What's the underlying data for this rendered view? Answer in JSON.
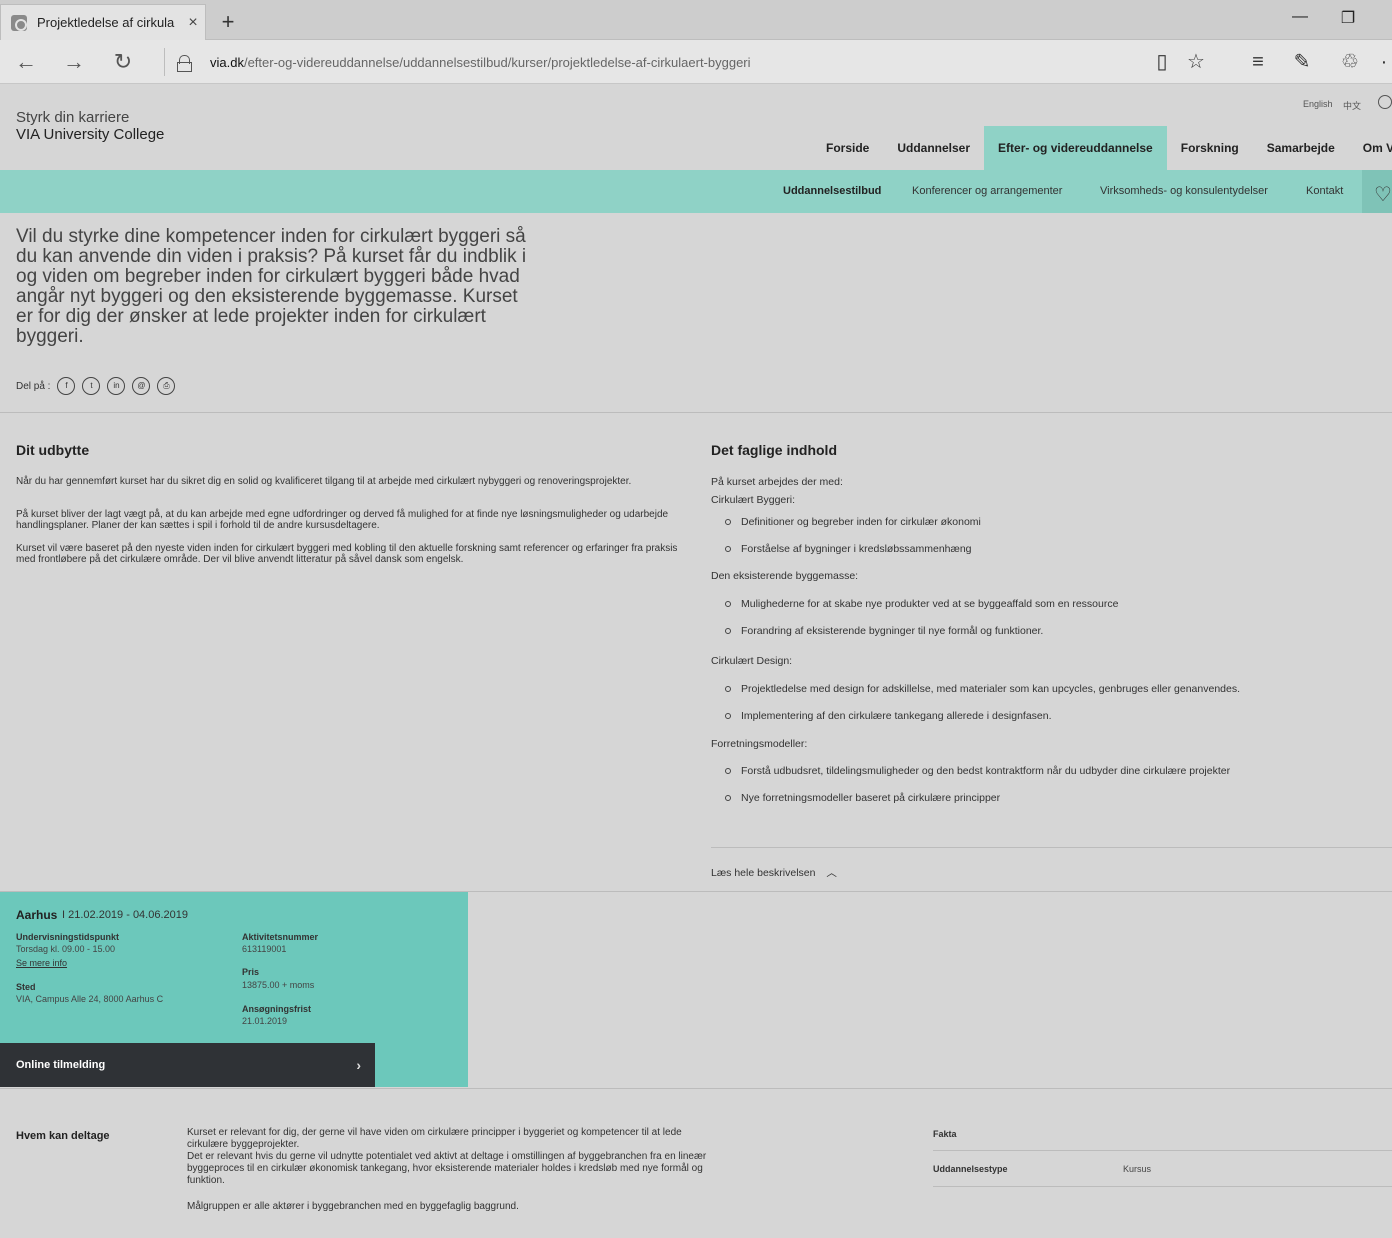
{
  "browser": {
    "tab_title": "Projektledelse af cirkula",
    "close_label": "×",
    "new_tab_label": "+",
    "minimize_label": "—",
    "restore_label": "❐",
    "more_label": "·",
    "url_domain": "via.dk",
    "url_path": "/efter-og-videreuddannelse/uddannelsestilbud/kurser/projektledelse-af-cirkulaert-byggeri"
  },
  "header": {
    "tagline": "Styrk din karriere",
    "college": "VIA University College",
    "lang_english": "English",
    "lang_chinese": "中文"
  },
  "main_nav": [
    {
      "label": "Forside"
    },
    {
      "label": "Uddannelser"
    },
    {
      "label": "Efter- og videreuddannelse"
    },
    {
      "label": "Forskning"
    },
    {
      "label": "Samarbejde"
    },
    {
      "label": "Om VIA"
    }
  ],
  "sub_nav": [
    {
      "label": "Uddannelsestilbud"
    },
    {
      "label": "Konferencer og arrangementer"
    },
    {
      "label": "Virksomheds- og konsulentydelser"
    },
    {
      "label": "Kontakt"
    }
  ],
  "intro": "Vil du styrke dine kompetencer inden for cirkulært byggeri så du kan anvende din viden i praksis? På kurset får du indblik i og viden om begreber inden for cirkulært byggeri både hvad angår nyt byggeri og den eksisterende byggemasse. Kurset er for dig der ønsker at lede projekter inden for cirkulært byggeri.",
  "share": {
    "label": "Del på :",
    "icons": [
      "f",
      "t",
      "in",
      "@",
      "⎙"
    ]
  },
  "udbytte": {
    "heading": "Dit udbytte",
    "p1": "Når du har gennemført kurset har du sikret dig en solid og kvalificeret tilgang til at arbejde med cirkulært nybyggeri og renoveringsprojekter.",
    "p2": "På kurset bliver der lagt vægt på, at du kan arbejde med egne udfordringer og derved få mulighed for at finde nye løsningsmuligheder og udarbejde handlingsplaner. Planer der kan sættes i spil i forhold til de andre kursusdeltagere.",
    "p3": "Kurset vil være baseret på den nyeste viden inden for cirkulært byggeri med kobling til den aktuelle forskning samt referencer og erfaringer fra praksis med frontløbere på det cirkulære område. Der vil blive anvendt litteratur på såvel dansk som engelsk."
  },
  "indhold": {
    "heading": "Det faglige indhold",
    "intro": "På kurset arbejdes der med:",
    "groups": [
      {
        "label": "Cirkulært Byggeri:",
        "items": [
          "Definitioner og begreber inden for cirkulær økonomi",
          "Forståelse af bygninger i kredsløbssammenhæng"
        ]
      },
      {
        "label": "Den eksisterende byggemasse:",
        "items": [
          "Mulighederne for at skabe nye produkter ved at se byggeaffald som en ressource",
          "Forandring af eksisterende bygninger til nye formål og funktioner."
        ]
      },
      {
        "label": "Cirkulært Design:",
        "items": [
          "Projektledelse med design for adskillelse, med materialer som kan upcycles, genbruges eller genanvendes.",
          "Implementering af den cirkulære tankegang allerede i designfasen."
        ]
      },
      {
        "label": "Forretningsmodeller:",
        "items": [
          "Forstå udbudsret, tildelingsmuligheder og den bedst kontraktform når du udbyder dine cirkulære projekter",
          "Nye forretningsmodeller baseret på cirkulære principper"
        ]
      }
    ],
    "read_more": "Læs hele beskrivelsen"
  },
  "course": {
    "city": "Aarhus",
    "dates": "I  21.02.2019 - 04.06.2019",
    "time_label": "Undervisningstidspunkt",
    "time_value": "Torsdag kl. 09.00 - 15.00",
    "more_info": "Se mere info",
    "place_label": "Sted",
    "place_value": "VIA, Campus Alle 24, 8000 Aarhus C",
    "activity_label": "Aktivitetsnummer",
    "activity_value": "613119001",
    "price_label": "Pris",
    "price_value": "13875.00 + moms",
    "deadline_label": "Ansøgningsfrist",
    "deadline_value": "21.01.2019",
    "signup_label": "Online tilmelding"
  },
  "bottom": {
    "heading": "Hvem kan deltage",
    "p1": "Kurset er relevant for dig, der gerne vil have viden om cirkulære principper i byggeriet og kompetencer til at lede cirkulære byggeprojekter.",
    "p2": "Det er relevant hvis du gerne vil udnytte potentialet ved aktivt at deltage i omstillingen af byggebranchen fra en lineær byggeproces til en cirkulær økonomisk tankegang, hvor eksisterende materialer holdes i kredsløb med nye formål og funktion.",
    "p3": "Målgruppen er alle aktører i byggebranchen med en byggefaglig baggrund.",
    "fakta": "Fakta",
    "type_label": "Uddannelsestype",
    "type_value": "Kursus"
  }
}
